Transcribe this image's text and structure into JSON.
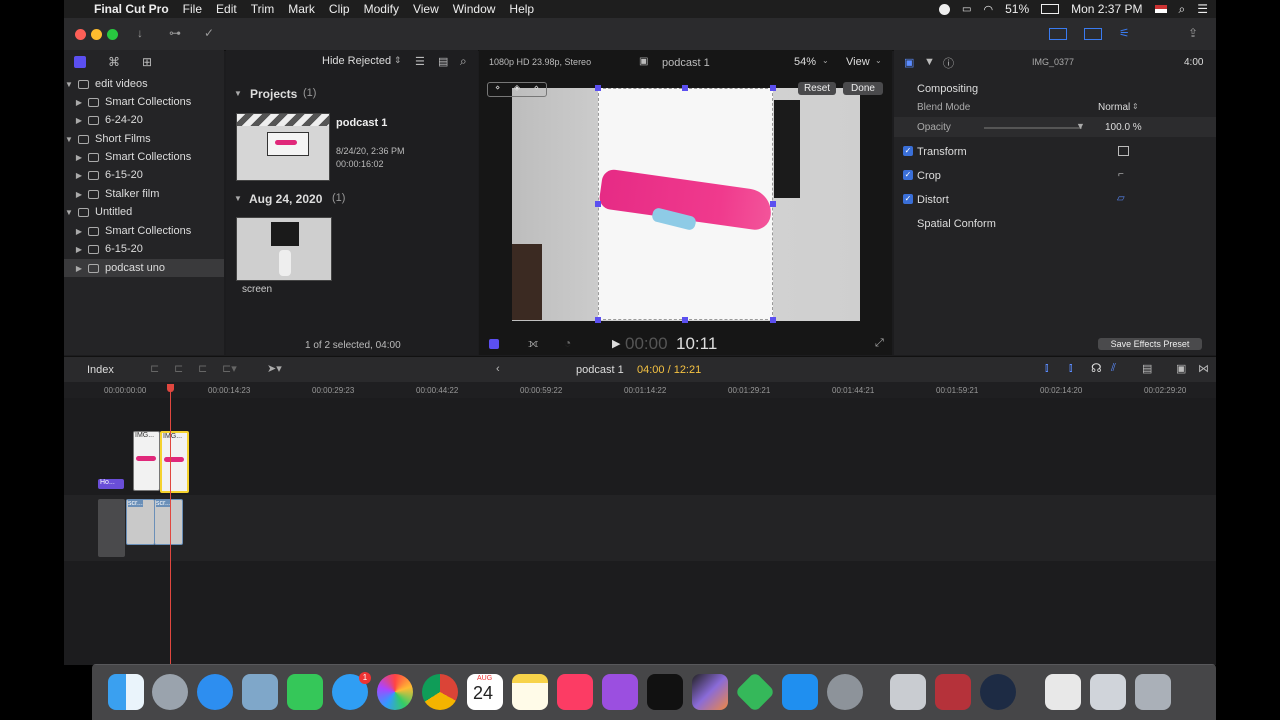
{
  "menubar": {
    "app": "Final Cut Pro",
    "items": [
      "File",
      "Edit",
      "Trim",
      "Mark",
      "Clip",
      "Modify",
      "View",
      "Window",
      "Help"
    ],
    "battery": "51%",
    "clock": "Mon 2:37 PM"
  },
  "browser": {
    "filter": "Hide Rejected",
    "libraries": [
      {
        "label": "edit videos"
      },
      {
        "label": "Smart Collections"
      },
      {
        "label": "6-24-20"
      },
      {
        "label": "Short Films"
      },
      {
        "label": "Smart Collections"
      },
      {
        "label": "6-15-20"
      },
      {
        "label": "Stalker film"
      },
      {
        "label": "Untitled"
      },
      {
        "label": "Smart Collections"
      },
      {
        "label": "6-15-20"
      },
      {
        "label": "podcast uno"
      }
    ],
    "projects_header": "Projects",
    "projects_count": "(1)",
    "project": {
      "name": "podcast 1",
      "date": "8/24/20, 2:36 PM",
      "duration": "00:00:16:02"
    },
    "date_header": "Aug 24, 2020",
    "date_count": "(1)",
    "clip_name": "screen",
    "status": "1 of 2 selected, 04:00"
  },
  "viewer": {
    "format": "1080p HD 23.98p, Stereo",
    "title": "podcast 1",
    "zoom": "54%",
    "view": "View",
    "reset": "Reset",
    "done": "Done",
    "timecode_dim": "00:00",
    "timecode": "10:11"
  },
  "inspector": {
    "clip_name": "IMG_0377",
    "clip_dur": "4:00",
    "compositing": "Compositing",
    "blend_mode_label": "Blend Mode",
    "blend_mode_value": "Normal",
    "opacity_label": "Opacity",
    "opacity_value": "100.0 %",
    "transform": "Transform",
    "crop": "Crop",
    "distort": "Distort",
    "spatial_conform": "Spatial Conform",
    "save_preset": "Save Effects Preset"
  },
  "timeline": {
    "index": "Index",
    "project": "podcast 1",
    "position": "04:00 / 12:21",
    "ruler": [
      "00:00:00:00",
      "00:00:14:23",
      "00:00:29:23",
      "00:00:44:22",
      "00:00:59:22",
      "00:01:14:22",
      "00:01:29:21",
      "00:01:44:21",
      "00:01:59:21",
      "00:02:14:20",
      "00:02:29:20"
    ],
    "clip1": "IMG...",
    "clip2": "IMG...",
    "title_clip": "Ho...",
    "screen_clip1": "scr...",
    "screen_clip2": "scr..."
  },
  "dock": {
    "calendar_month": "AUG",
    "calendar_day": "24",
    "messages_badge": "1"
  },
  "colors": {
    "accent": "#5b4ff0",
    "playhead": "#e0473f",
    "selection": "#f5d22e"
  }
}
